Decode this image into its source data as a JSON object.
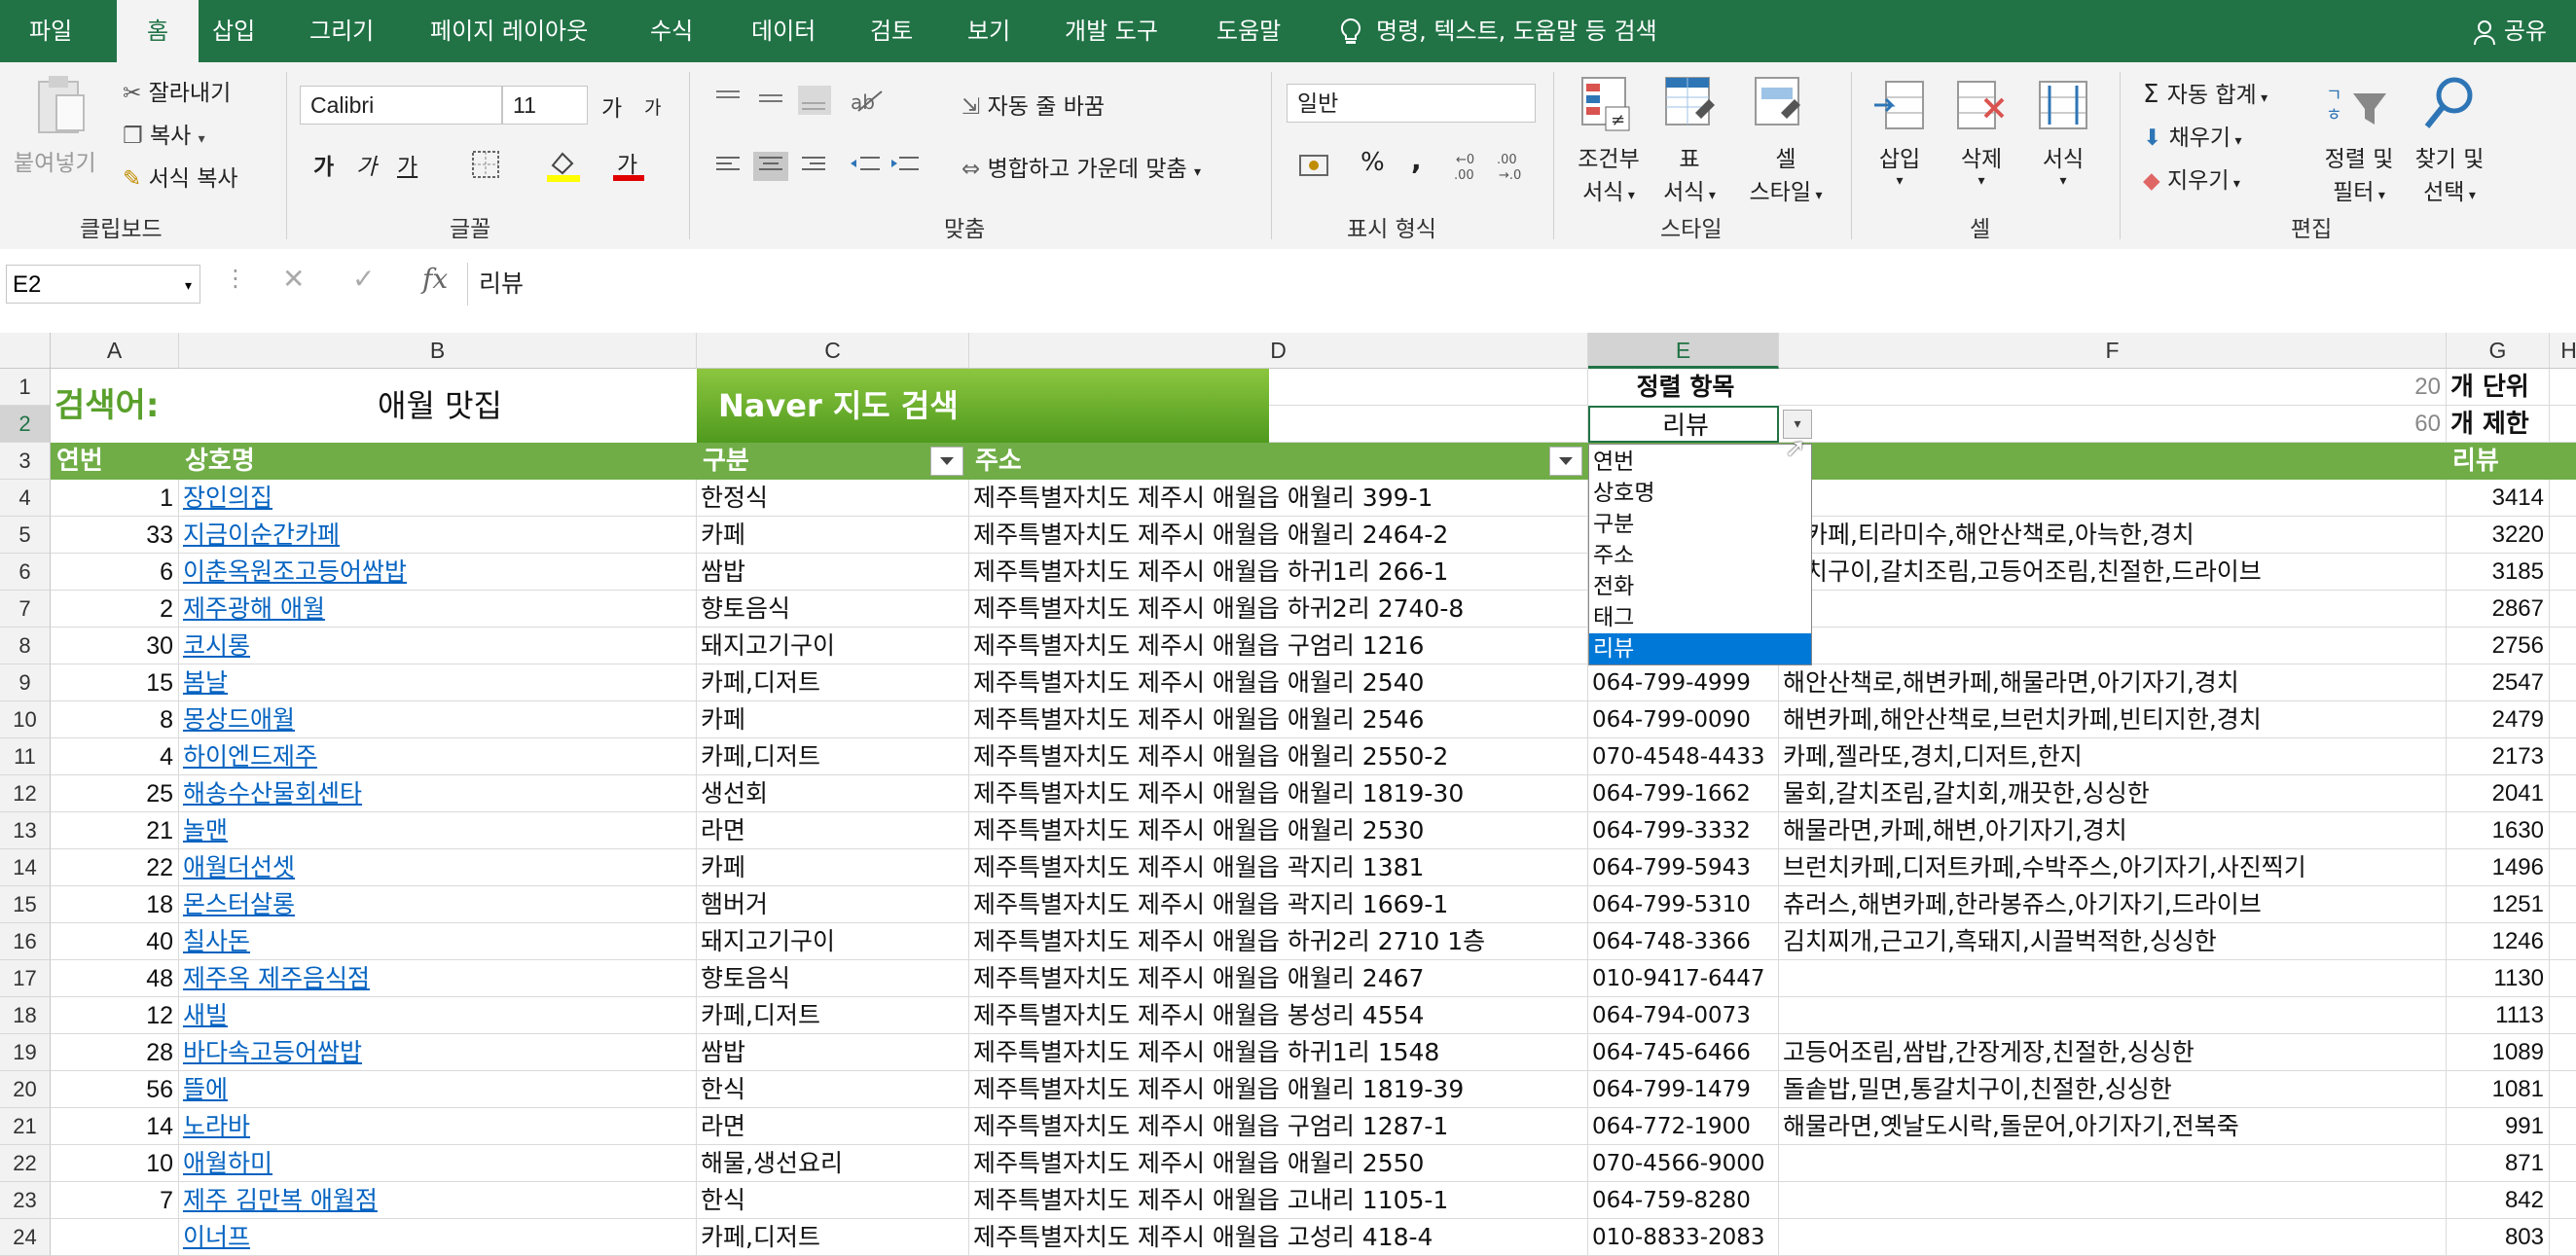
{
  "menu": {
    "tabs": [
      "파일",
      "홈",
      "삽입",
      "그리기",
      "페이지 레이아웃",
      "수식",
      "데이터",
      "검토",
      "보기",
      "개발 도구",
      "도움말"
    ],
    "active_tab": "홈",
    "tell_me": "명령, 텍스트, 도움말 등 검색",
    "share": "공유"
  },
  "ribbon": {
    "clipboard": {
      "paste": "붙여넣기",
      "cut": "잘라내기",
      "copy": "복사",
      "format_painter": "서식 복사",
      "label": "클립보드"
    },
    "font": {
      "name": "Calibri",
      "size": "11",
      "label": "글꼴",
      "bold": "가",
      "italic": "가",
      "underline": "가",
      "grow": "가",
      "shrink": "가",
      "font_color_glyph": "가"
    },
    "alignment": {
      "wrap": "자동 줄 바꿈",
      "merge": "병합하고 가운데 맞춤",
      "label": "맞춤"
    },
    "number": {
      "format": "일반",
      "label": "표시 형식",
      "percent": "%",
      "comma": ","
    },
    "styles": {
      "conditional": [
        "조건부",
        "서식"
      ],
      "table": [
        "표",
        "서식"
      ],
      "cell": [
        "셀",
        "스타일"
      ],
      "label": "스타일"
    },
    "cells": {
      "insert": "삽입",
      "delete": "삭제",
      "format": "서식",
      "label": "셀"
    },
    "editing": {
      "autosum": "자동 합계",
      "fill": "채우기",
      "clear": "지우기",
      "sort": [
        "정렬 및",
        "필터"
      ],
      "find": [
        "찾기 및",
        "선택"
      ],
      "label": "편집"
    }
  },
  "formula_bar": {
    "name_box": "E2",
    "content": "리뷰",
    "fx": "fx"
  },
  "columns": [
    "A",
    "B",
    "C",
    "D",
    "E",
    "F",
    "G",
    "H"
  ],
  "sheet": {
    "search_label": "검색어:",
    "search_value": "애월 맛집",
    "naver_button": "Naver 지도 검색",
    "sort_label": "정렬 항목",
    "sort_value": "리뷰",
    "unit_num": "20",
    "unit_label": "개 단위",
    "limit_num": "60",
    "limit_label": "개 제한",
    "headers": [
      "연번",
      "상호명",
      "구분",
      "주소",
      "",
      "그",
      "리뷰"
    ],
    "rows": [
      {
        "r": "4",
        "no": "1",
        "name": "장인의집",
        "cat": "한정식",
        "addr": "제주특별자치도 제주시 애월읍 애월리 399-1",
        "tel": "",
        "tag": "",
        "rev": "3414"
      },
      {
        "r": "5",
        "no": "33",
        "name": "지금이순간카페",
        "cat": "카페",
        "addr": "제주특별자치도 제주시 애월읍 애월리 2464-2",
        "tel": "",
        "tag": "변카페,티라미수,해안산책로,아늑한,경치",
        "rev": "3220"
      },
      {
        "r": "6",
        "no": "6",
        "name": "이춘옥원조고등어쌈밥",
        "cat": "쌈밥",
        "addr": "제주특별자치도 제주시 애월읍 하귀1리 266-1",
        "tel": "",
        "tag": "갈치구이,갈치조림,고등어조림,친절한,드라이브",
        "rev": "3185"
      },
      {
        "r": "7",
        "no": "2",
        "name": "제주광해 애월",
        "cat": "향토음식",
        "addr": "제주특별자치도 제주시 애월읍 하귀2리 2740-8",
        "tel": "",
        "tag": "",
        "rev": "2867"
      },
      {
        "r": "8",
        "no": "30",
        "name": "코시롱",
        "cat": "돼지고기구이",
        "addr": "제주특별자치도 제주시 애월읍 구엄리 1216",
        "tel": "",
        "tag": "",
        "rev": "2756"
      },
      {
        "r": "9",
        "no": "15",
        "name": "봄날",
        "cat": "카페,디저트",
        "addr": "제주특별자치도 제주시 애월읍 애월리 2540",
        "tel": "064-799-4999",
        "tag": "해안산책로,해변카페,해물라면,아기자기,경치",
        "rev": "2547"
      },
      {
        "r": "10",
        "no": "8",
        "name": "몽상드애월",
        "cat": "카페",
        "addr": "제주특별자치도 제주시 애월읍 애월리 2546",
        "tel": "064-799-0090",
        "tag": "해변카페,해안산책로,브런치카페,빈티지한,경치",
        "rev": "2479"
      },
      {
        "r": "11",
        "no": "4",
        "name": "하이엔드제주",
        "cat": "카페,디저트",
        "addr": "제주특별자치도 제주시 애월읍 애월리 2550-2",
        "tel": "070-4548-4433",
        "tag": "카페,젤라또,경치,디저트,한지",
        "rev": "2173"
      },
      {
        "r": "12",
        "no": "25",
        "name": "해송수산물회센타",
        "cat": "생선회",
        "addr": "제주특별자치도 제주시 애월읍 애월리 1819-30",
        "tel": "064-799-1662",
        "tag": "물회,갈치조림,갈치회,깨끗한,싱싱한",
        "rev": "2041"
      },
      {
        "r": "13",
        "no": "21",
        "name": "놀맨",
        "cat": "라면",
        "addr": "제주특별자치도 제주시 애월읍 애월리 2530",
        "tel": "064-799-3332",
        "tag": "해물라면,카페,해변,아기자기,경치",
        "rev": "1630"
      },
      {
        "r": "14",
        "no": "22",
        "name": "애월더선셋",
        "cat": "카페",
        "addr": "제주특별자치도 제주시 애월읍 곽지리 1381",
        "tel": "064-799-5943",
        "tag": "브런치카페,디저트카페,수박주스,아기자기,사진찍기",
        "rev": "1496"
      },
      {
        "r": "15",
        "no": "18",
        "name": "몬스터살롱",
        "cat": "햄버거",
        "addr": "제주특별자치도 제주시 애월읍 곽지리 1669-1",
        "tel": "064-799-5310",
        "tag": "츄러스,해변카페,한라봉쥬스,아기자기,드라이브",
        "rev": "1251"
      },
      {
        "r": "16",
        "no": "40",
        "name": "칠사돈",
        "cat": "돼지고기구이",
        "addr": "제주특별자치도 제주시 애월읍 하귀2리 2710 1층",
        "tel": "064-748-3366",
        "tag": "김치찌개,근고기,흑돼지,시끌벅적한,싱싱한",
        "rev": "1246"
      },
      {
        "r": "17",
        "no": "48",
        "name": "제주옥 제주음식점",
        "cat": "향토음식",
        "addr": "제주특별자치도 제주시 애월읍 애월리 2467",
        "tel": "010-9417-6447",
        "tag": "",
        "rev": "1130"
      },
      {
        "r": "18",
        "no": "12",
        "name": "새빌",
        "cat": "카페,디저트",
        "addr": "제주특별자치도 제주시 애월읍 봉성리 4554",
        "tel": "064-794-0073",
        "tag": "",
        "rev": "1113"
      },
      {
        "r": "19",
        "no": "28",
        "name": "바다속고등어쌈밥",
        "cat": "쌈밥",
        "addr": "제주특별자치도 제주시 애월읍 하귀1리 1548",
        "tel": "064-745-6466",
        "tag": "고등어조림,쌈밥,간장게장,친절한,싱싱한",
        "rev": "1089"
      },
      {
        "r": "20",
        "no": "56",
        "name": "뜰에",
        "cat": "한식",
        "addr": "제주특별자치도 제주시 애월읍 애월리 1819-39",
        "tel": "064-799-1479",
        "tag": "돌솥밥,밀면,통갈치구이,친절한,싱싱한",
        "rev": "1081"
      },
      {
        "r": "21",
        "no": "14",
        "name": "노라바",
        "cat": "라면",
        "addr": "제주특별자치도 제주시 애월읍 구엄리 1287-1",
        "tel": "064-772-1900",
        "tag": "해물라면,옛날도시락,돌문어,아기자기,전복죽",
        "rev": "991"
      },
      {
        "r": "22",
        "no": "10",
        "name": "애월하미",
        "cat": "해물,생선요리",
        "addr": "제주특별자치도 제주시 애월읍 애월리 2550",
        "tel": "070-4566-9000",
        "tag": "",
        "rev": "871"
      },
      {
        "r": "23",
        "no": "7",
        "name": "제주 김만복 애월점",
        "cat": "한식",
        "addr": "제주특별자치도 제주시 애월읍 고내리 1105-1",
        "tel": "064-759-8280",
        "tag": "",
        "rev": "842"
      },
      {
        "r": "24",
        "no": "",
        "name": "이너프",
        "cat": "카페,디저트",
        "addr": "제주특별자치도 제주시 애월읍 고성리 418-4",
        "tel": "010-8833-2083",
        "tag": "",
        "rev": "803"
      }
    ]
  },
  "dropdown": {
    "options": [
      "연번",
      "상호명",
      "구분",
      "주소",
      "전화",
      "태그",
      "리뷰"
    ],
    "selected": "리뷰"
  },
  "colors": {
    "excel_green": "#217346",
    "header_green": "#70ad47",
    "label_green": "#5aa02c",
    "link": "#0563c1",
    "selected_option": "#0078d7"
  }
}
